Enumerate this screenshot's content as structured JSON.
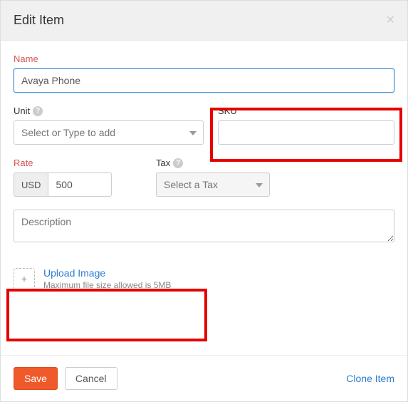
{
  "header": {
    "title": "Edit Item"
  },
  "name": {
    "label": "Name",
    "value": "Avaya Phone"
  },
  "unit": {
    "label": "Unit",
    "placeholder": "Select or Type to add"
  },
  "sku": {
    "label": "SKU",
    "value": ""
  },
  "rate": {
    "label": "Rate",
    "currency": "USD",
    "value": "500"
  },
  "tax": {
    "label": "Tax",
    "placeholder": "Select a Tax"
  },
  "description": {
    "placeholder": "Description"
  },
  "upload": {
    "link": "Upload Image",
    "hint": "Maximum file size allowed is 5MB"
  },
  "footer": {
    "save": "Save",
    "cancel": "Cancel",
    "clone": "Clone Item"
  }
}
